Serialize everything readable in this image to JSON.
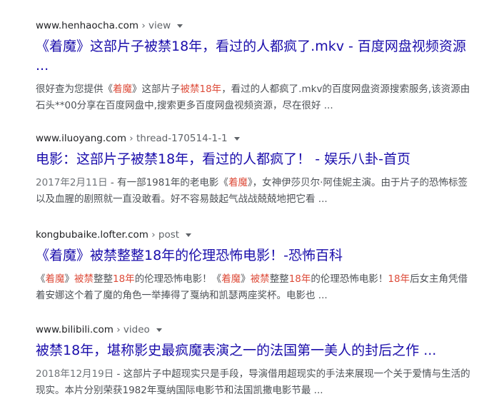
{
  "results": [
    {
      "domain": "www.henhaocha.com",
      "path": " › view",
      "title": "《着魔》这部片子被禁18年，看过的人都疯了.mkv - 百度网盘视频资源 ...",
      "snippet": [
        {
          "t": "很好查为您提供《",
          "h": false
        },
        {
          "t": "着魔",
          "h": true
        },
        {
          "t": "》这部片子",
          "h": false
        },
        {
          "t": "被禁18年",
          "h": true
        },
        {
          "t": "，看过的人都疯了.mkv的百度网盘资源搜索服务,该资源由石头**00分享在百度网盘中,搜索更多百度网盘视频资源，尽在很好 ...",
          "h": false
        }
      ]
    },
    {
      "domain": "www.iluoyang.com",
      "path": " › thread-170514-1-1",
      "title": "电影：这部片子被禁18年，看过的人都疯了！ - 娱乐八卦-首页",
      "date": "2017年2月11日",
      "snippet": [
        {
          "t": " - 有一部1981年的老电影《",
          "h": false
        },
        {
          "t": "着魔",
          "h": true
        },
        {
          "t": "》，女神伊莎贝尔·阿佳妮主演。由于片子的恐怖标签以及血腥的剧照就一直没敢看。好不容易鼓起气战战兢兢地把它看 ...",
          "h": false
        }
      ]
    },
    {
      "domain": "kongbubaike.lofter.com",
      "path": " › post",
      "title": "《着魔》被禁整整18年的伦理恐怖电影！-恐怖百科",
      "snippet": [
        {
          "t": "《",
          "h": false
        },
        {
          "t": "着魔",
          "h": true
        },
        {
          "t": "》",
          "h": false
        },
        {
          "t": "被禁",
          "h": true
        },
        {
          "t": "整整",
          "h": false
        },
        {
          "t": "18年",
          "h": true
        },
        {
          "t": "的伦理恐怖电影！《",
          "h": false
        },
        {
          "t": "着魔",
          "h": true
        },
        {
          "t": "》",
          "h": false
        },
        {
          "t": "被禁",
          "h": true
        },
        {
          "t": "整整",
          "h": false
        },
        {
          "t": "18年",
          "h": true
        },
        {
          "t": "的伦理恐怖电影！",
          "h": false
        },
        {
          "t": "18年",
          "h": true
        },
        {
          "t": "后女主角凭借着安娜这个着了魔的角色一举捧得了戛纳和凯瑟两座奖杯。电影也 ...",
          "h": false
        }
      ]
    },
    {
      "domain": "www.bilibili.com",
      "path": " › video",
      "title": "被禁18年，堪称影史最疯魔表演之一的法国第一美人的封后之作 ...",
      "date": "2018年12月19日",
      "snippet": [
        {
          "t": " - 这部片子中超现实只是手段，导演借用超现实的手法来展现一个关于爱情与生活的现实。本片分别荣获1982年戛纳国际电影节和法国凯撒电影节最 ...",
          "h": false
        }
      ]
    }
  ],
  "colors": {
    "title": "#1a0dab",
    "snippet": "#4d5156",
    "highlight": "#dd4b39"
  },
  "icons": {
    "caret": "chevron-down-icon"
  }
}
